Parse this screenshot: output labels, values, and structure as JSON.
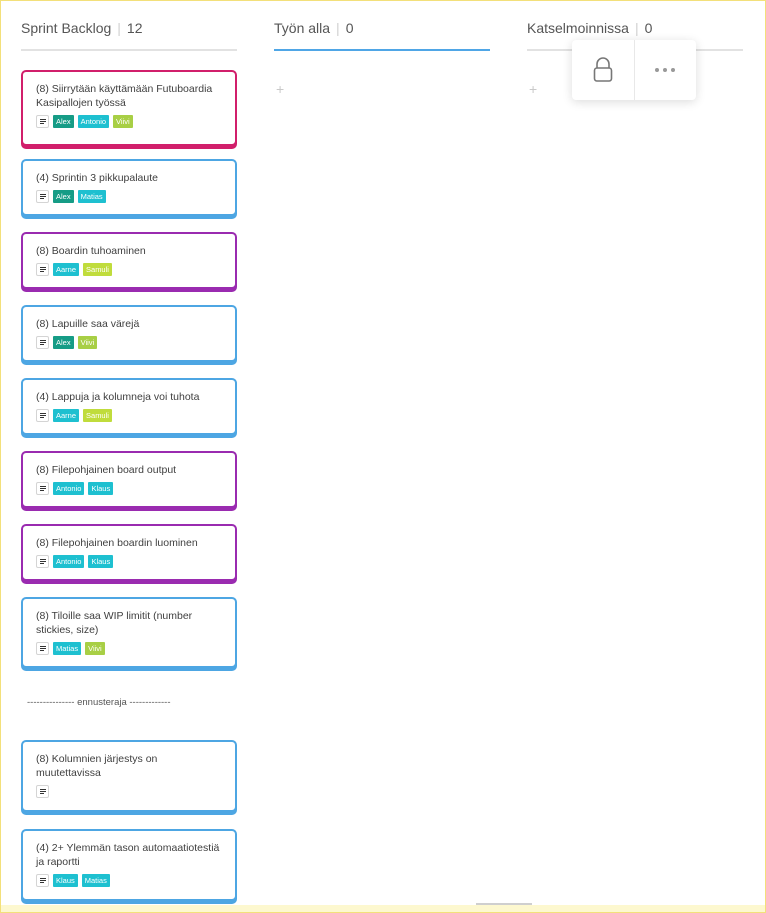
{
  "columns": [
    {
      "title": "Sprint Backlog",
      "count": "12"
    },
    {
      "title": "Työn alla",
      "count": "0",
      "add": "+"
    },
    {
      "title": "Katselmoinnissa",
      "count": "0",
      "add": "+"
    }
  ],
  "cards": [
    {
      "title": "(8) Siirrytään käyttämään Futuboardia Kasipallojen työssä",
      "tags": [
        "Alex",
        "Antonio",
        "Viivi"
      ]
    },
    {
      "title": "(4) Sprintin 3 pikkupalaute",
      "tags": [
        "Alex",
        "Matias"
      ]
    },
    {
      "title": "(8) Boardin tuhoaminen",
      "tags": [
        "Aarne",
        "Samuli"
      ]
    },
    {
      "title": "(8) Lapuille saa värejä",
      "tags": [
        "Alex",
        "Viivi"
      ]
    },
    {
      "title": "(4) Lappuja ja kolumneja voi tuhota",
      "tags": [
        "Aarne",
        "Samuli"
      ]
    },
    {
      "title": "(8) Filepohjainen board output",
      "tags": [
        "Antonio",
        "Klaus"
      ]
    },
    {
      "title": "(8) Filepohjainen boardin luominen",
      "tags": [
        "Antonio",
        "Klaus"
      ]
    },
    {
      "title": "(8) Tiloille saa WIP limitit (number stickies, size)",
      "tags": [
        "Matias",
        "Viivi"
      ]
    },
    {
      "title": "(8) Kolumnien järjestys on muutettavissa",
      "tags": []
    },
    {
      "title": "(4) 2+ Ylemmän tason automaatiotestiä ja raportti",
      "tags": [
        "Klaus",
        "Matias"
      ]
    }
  ],
  "separator": "--------------- ennusteraja -------------",
  "toolbar": {
    "lock_icon": "lock-icon",
    "more_icon": "more-horizontal-icon"
  },
  "colors": {
    "card_blue": "#4da6e3",
    "card_magenta": "#d11f6b",
    "card_purple": "#9a2bb0",
    "Alex": "#169c86",
    "Antonio": "#1ec0d0",
    "Viivi": "#a8cf45",
    "Matias": "#1ec0d0",
    "Aarne": "#1ec0d0",
    "Samuli": "#c0dc3c",
    "Klaus": "#1ec0d0"
  }
}
